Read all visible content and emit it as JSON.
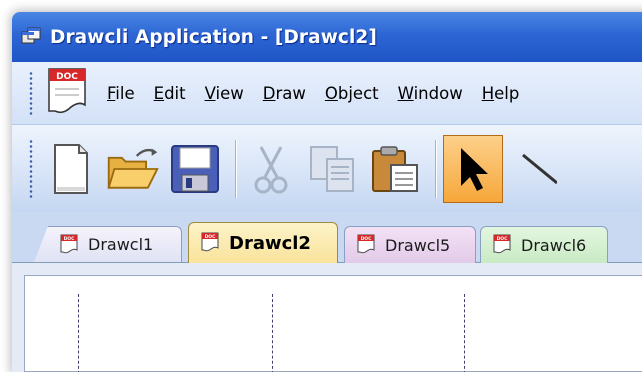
{
  "window": {
    "title": "Drawcli Application - [Drawcl2]",
    "title_icon": "app-window-icon"
  },
  "menubar": {
    "doc_icon": "doc-icon",
    "items": [
      {
        "label_u": "F",
        "label_rest": "ile"
      },
      {
        "label_u": "E",
        "label_rest": "dit"
      },
      {
        "label_u": "V",
        "label_rest": "iew"
      },
      {
        "label_u": "D",
        "label_rest": "raw"
      },
      {
        "label_u": "O",
        "label_rest": "bject"
      },
      {
        "label_u": "W",
        "label_rest": "indow"
      },
      {
        "label_u": "H",
        "label_rest": "elp"
      }
    ]
  },
  "toolbar": {
    "buttons": [
      {
        "icon": "new-document-icon",
        "enabled": true
      },
      {
        "icon": "open-folder-icon",
        "enabled": true
      },
      {
        "icon": "save-disk-icon",
        "enabled": true
      },
      {
        "icon": "cut-scissors-icon",
        "enabled": false
      },
      {
        "icon": "copy-icon",
        "enabled": false
      },
      {
        "icon": "paste-clipboard-icon",
        "enabled": true
      },
      {
        "icon": "select-arrow-icon",
        "enabled": true,
        "active": true
      },
      {
        "icon": "line-tool-icon",
        "enabled": true
      }
    ]
  },
  "tabs": [
    {
      "label": "Drawcl1",
      "active": false,
      "color": "#e6e4f6"
    },
    {
      "label": "Drawcl2",
      "active": true,
      "color": "#f9e39b"
    },
    {
      "label": "Drawcl5",
      "active": false,
      "color": "#e2cbe9"
    },
    {
      "label": "Drawcl6",
      "active": false,
      "color": "#c9eac4"
    }
  ],
  "colors": {
    "titlebar": "#2d66d4",
    "menubar": "#dbe7f8",
    "active_tool": "#f6a73a"
  }
}
